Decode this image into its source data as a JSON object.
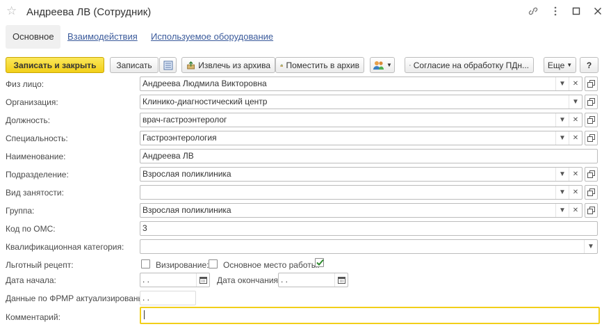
{
  "window": {
    "title": "Андреева ЛВ (Сотрудник)"
  },
  "tabs": [
    {
      "label": "Основное"
    },
    {
      "label": "Взаимодействия"
    },
    {
      "label": "Используемое оборудование"
    }
  ],
  "toolbar": {
    "save_close": "Записать и закрыть",
    "save": "Записать",
    "unarchive": "Извлечь из архива",
    "archive": "Поместить в архив",
    "consent": "Согласие на обработку ПДн...",
    "more": "Еще",
    "help": "?"
  },
  "form": {
    "person": {
      "label": "Физ лицо:",
      "value": "Андреева Людмила Викторовна"
    },
    "organization": {
      "label": "Организация:",
      "value": "Клинико-диагностический центр"
    },
    "position": {
      "label": "Должность:",
      "value": "врач-гастроэнтеролог"
    },
    "specialty": {
      "label": "Специальность:",
      "value": "Гастроэнтерология"
    },
    "name": {
      "label": "Наименование:",
      "value": "Андреева ЛВ"
    },
    "department": {
      "label": "Подразделение:",
      "value": "Взрослая поликлиника"
    },
    "employment": {
      "label": "Вид занятости:",
      "value": ""
    },
    "group": {
      "label": "Группа:",
      "value": "Взрослая поликлиника"
    },
    "oms_code": {
      "label": "Код по ОМС:",
      "value": "3"
    },
    "qualification": {
      "label": "Квалификационная категория:",
      "value": ""
    },
    "preferential": {
      "label": "Льготный рецепт:",
      "checked": false
    },
    "approval": {
      "label": "Визирование:",
      "checked": false
    },
    "main_job": {
      "label": "Основное место работы:",
      "checked": true
    },
    "start_date": {
      "label": "Дата начала:",
      "value": " .  ."
    },
    "end_date": {
      "label": "Дата окончания:",
      "value": " .  ."
    },
    "frmr": {
      "label": "Данные по ФРМР актуализированы:",
      "value": " .  ."
    },
    "comment": {
      "label": "Комментарий:",
      "value": ""
    }
  },
  "colors": {
    "accent": "#f2cf19",
    "link": "#3a5a9b",
    "check": "#2e8b2e"
  }
}
